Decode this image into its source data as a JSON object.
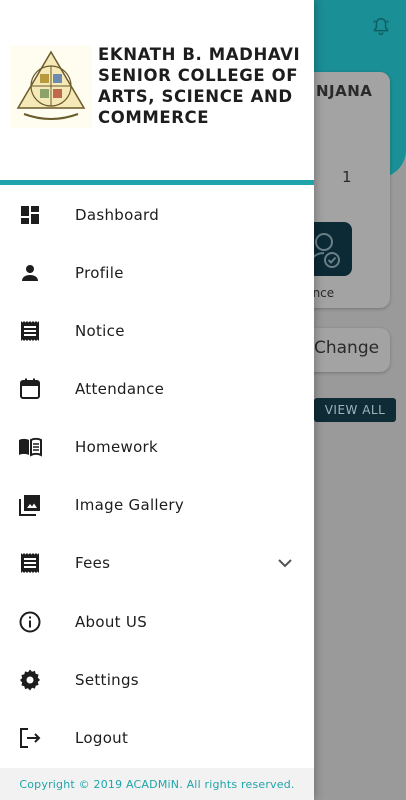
{
  "background": {
    "name_fragment": "NJANA",
    "count": "1",
    "tile_label": "ndance",
    "change_label": "Change",
    "view_all_label": "VIEW ALL",
    "header_color": "#1fa4ab"
  },
  "drawer": {
    "college_name": "EKNATH B. MADHAVI SENIOR COLLEGE OF ARTS, SCIENCE AND COMMERCE",
    "accent_color": "#1fa4ab",
    "menu": [
      {
        "label": "Dashboard",
        "icon": "dashboard-icon"
      },
      {
        "label": "Profile",
        "icon": "person-icon"
      },
      {
        "label": "Notice",
        "icon": "notice-icon"
      },
      {
        "label": "Attendance",
        "icon": "calendar-icon"
      },
      {
        "label": "Homework",
        "icon": "book-icon"
      },
      {
        "label": "Image Gallery",
        "icon": "image-gallery-icon"
      },
      {
        "label": "Fees",
        "icon": "receipt-icon",
        "expandable": true
      },
      {
        "label": "About US",
        "icon": "info-icon"
      },
      {
        "label": "Settings",
        "icon": "gear-icon"
      },
      {
        "label": "Logout",
        "icon": "logout-icon"
      }
    ],
    "footer": "Copyright © 2019 ACADMiN. All rights  reserved."
  }
}
